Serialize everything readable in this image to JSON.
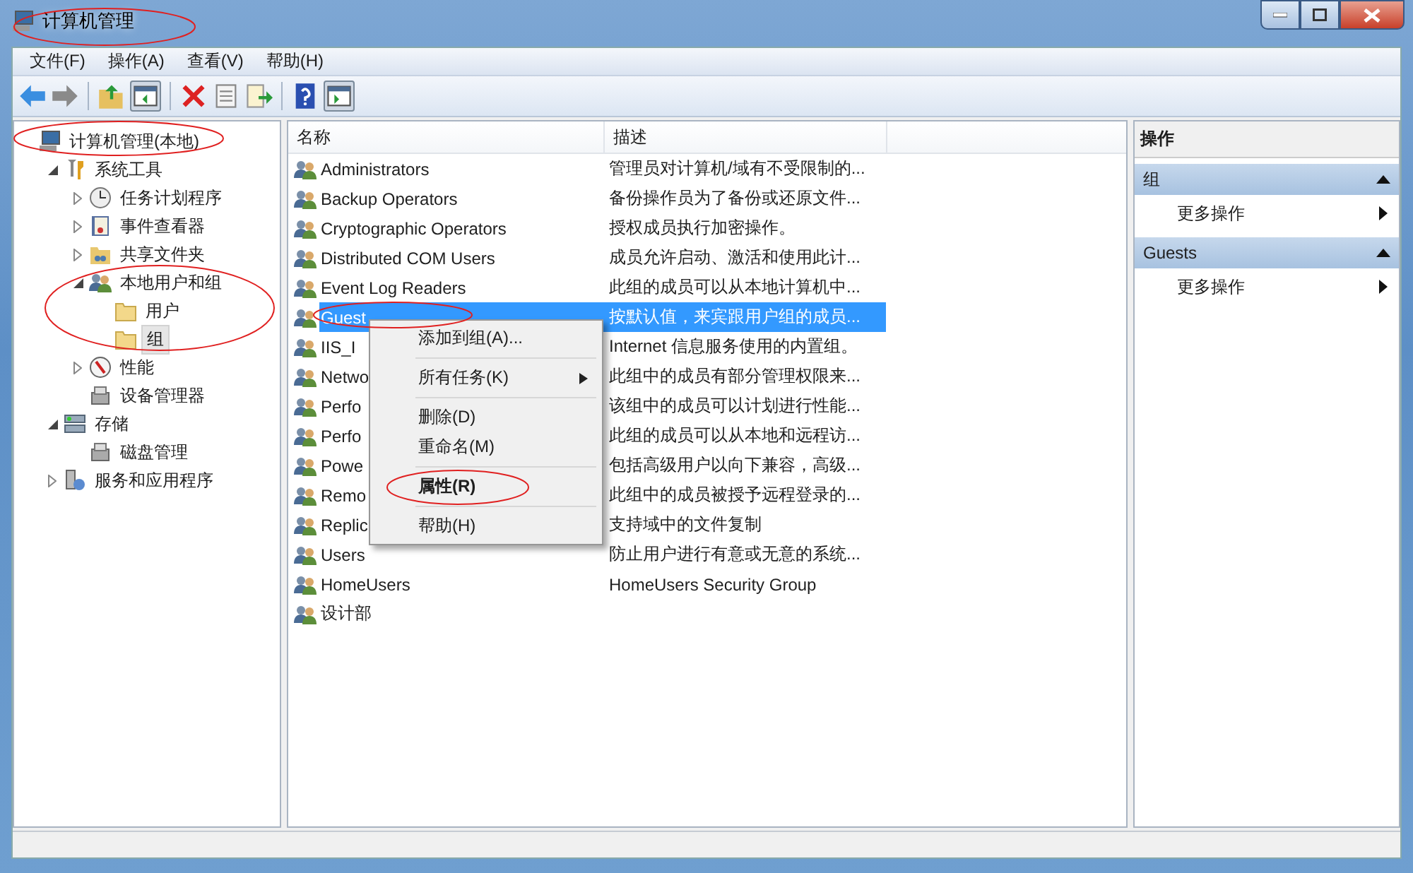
{
  "window": {
    "title": "计算机管理"
  },
  "menu": [
    "文件(F)",
    "操作(A)",
    "查看(V)",
    "帮助(H)"
  ],
  "toolbar": [
    {
      "kind": "back"
    },
    {
      "kind": "forward"
    },
    {
      "kind": "sep"
    },
    {
      "kind": "up"
    },
    {
      "kind": "tree"
    },
    {
      "kind": "sep"
    },
    {
      "kind": "delete"
    },
    {
      "kind": "props"
    },
    {
      "kind": "export"
    },
    {
      "kind": "sep"
    },
    {
      "kind": "help"
    },
    {
      "kind": "pane"
    }
  ],
  "tree": [
    {
      "label": "计算机管理(本地)",
      "kind": "computer",
      "selected": false,
      "children": [
        {
          "label": "系统工具",
          "kind": "tools",
          "expanded": true,
          "selected": false,
          "children": [
            {
              "label": "任务计划程序",
              "kind": "clock",
              "expanded": false,
              "selected": false
            },
            {
              "label": "事件查看器",
              "kind": "log",
              "expanded": false,
              "selected": false
            },
            {
              "label": "共享文件夹",
              "kind": "share",
              "expanded": false,
              "selected": false
            },
            {
              "label": "本地用户和组",
              "kind": "users",
              "expanded": true,
              "selected": false,
              "children": [
                {
                  "label": "用户",
                  "kind": "folder",
                  "selected": false
                },
                {
                  "label": "组",
                  "kind": "folder",
                  "selected": true
                }
              ]
            },
            {
              "label": "性能",
              "kind": "perf",
              "expanded": false,
              "selected": false
            },
            {
              "label": "设备管理器",
              "kind": "device",
              "selected": false
            }
          ]
        },
        {
          "label": "存储",
          "kind": "storage",
          "expanded": true,
          "selected": false,
          "children": [
            {
              "label": "磁盘管理",
              "kind": "device",
              "selected": false
            }
          ]
        },
        {
          "label": "服务和应用程序",
          "kind": "services",
          "expanded": false,
          "selected": false
        }
      ]
    }
  ],
  "table": {
    "columns": [
      "名称",
      "描述"
    ],
    "rows": [
      {
        "name": "Administrators",
        "description": "管理员对计算机/域有不受限制的...",
        "selected": false
      },
      {
        "name": "Backup Operators",
        "description": "备份操作员为了备份或还原文件...",
        "selected": false
      },
      {
        "name": "Cryptographic Operators",
        "description": "授权成员执行加密操作。",
        "selected": false
      },
      {
        "name": "Distributed COM Users",
        "description": "成员允许启动、激活和使用此计...",
        "selected": false
      },
      {
        "name": "Event Log Readers",
        "description": "此组的成员可以从本地计算机中...",
        "selected": false
      },
      {
        "name": "Guest",
        "description": "按默认值，来宾跟用户组的成员...",
        "selected": true
      },
      {
        "name": "IIS_I",
        "description": "Internet 信息服务使用的内置组。",
        "selected": false
      },
      {
        "name": "Netwo",
        "description": "此组中的成员有部分管理权限来...",
        "selected": false
      },
      {
        "name": "Perfo",
        "description": "该组中的成员可以计划进行性能...",
        "selected": false
      },
      {
        "name": "Perfo",
        "description": "此组的成员可以从本地和远程访...",
        "selected": false
      },
      {
        "name": "Powe",
        "description": "包括高级用户以向下兼容，高级...",
        "selected": false
      },
      {
        "name": "Remo",
        "description": "此组中的成员被授予远程登录的...",
        "selected": false
      },
      {
        "name": "Replic",
        "description": "支持域中的文件复制",
        "selected": false
      },
      {
        "name": "Users",
        "description": "防止用户进行有意或无意的系统...",
        "selected": false
      },
      {
        "name": "HomeUsers",
        "description": "HomeUsers Security Group",
        "selected": false
      },
      {
        "name": "设计部",
        "selected": false
      }
    ]
  },
  "context_menu": [
    {
      "kind": "item",
      "label": "添加到组(A)...",
      "default": false,
      "submenu": false
    },
    {
      "kind": "separator"
    },
    {
      "kind": "item",
      "label": "所有任务(K)",
      "default": false,
      "submenu": true
    },
    {
      "kind": "separator"
    },
    {
      "kind": "item",
      "label": "删除(D)",
      "default": false,
      "submenu": false
    },
    {
      "kind": "item",
      "label": "重命名(M)",
      "default": false,
      "submenu": false
    },
    {
      "kind": "separator"
    },
    {
      "kind": "item",
      "label": "属性(R)",
      "default": true,
      "submenu": false
    },
    {
      "kind": "separator"
    },
    {
      "kind": "item",
      "label": "帮助(H)",
      "default": false,
      "submenu": false
    }
  ],
  "actions": {
    "title": "操作",
    "sections": [
      {
        "title": "组",
        "expanded": true,
        "items": [
          "更多操作"
        ]
      },
      {
        "title": "Guests",
        "expanded": true,
        "items": [
          "更多操作"
        ]
      }
    ]
  }
}
